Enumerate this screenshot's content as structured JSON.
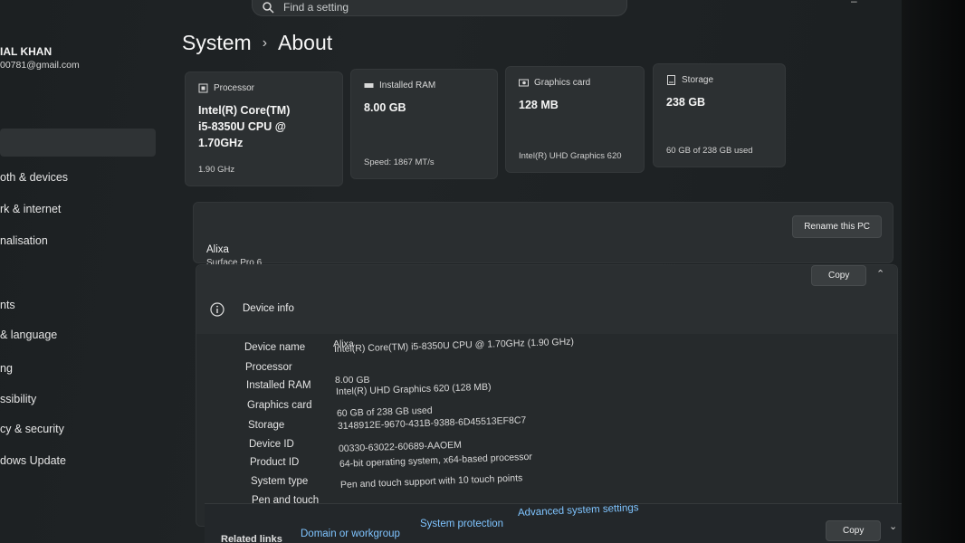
{
  "search": {
    "placeholder": "Find a setting"
  },
  "profile": {
    "name": "IAL KHAN",
    "email": "00781@gmail.com"
  },
  "nav": {
    "items": [
      {
        "label": "oth & devices"
      },
      {
        "label": "rk & internet"
      },
      {
        "label": "nalisation"
      },
      {
        "label": "nts"
      },
      {
        "label": "& language"
      },
      {
        "label": "ng"
      },
      {
        "label": "ssibility"
      },
      {
        "label": "cy & security"
      },
      {
        "label": "dows Update"
      }
    ]
  },
  "breadcrumb": {
    "parent": "System",
    "separator": "›",
    "current": "About"
  },
  "cards": [
    {
      "icon": "processor-icon",
      "title": "Processor",
      "value_lines": [
        "Intel(R) Core(TM)",
        "i5-8350U CPU @",
        "1.70GHz"
      ],
      "detail": "1.90 GHz"
    },
    {
      "icon": "ram-icon",
      "title": "Installed RAM",
      "value_lines": [
        "8.00 GB"
      ],
      "detail": "Speed: 1867 MT/s"
    },
    {
      "icon": "graphics-card-icon",
      "title": "Graphics card",
      "value_lines": [
        "128 MB"
      ],
      "detail": "Intel(R) UHD Graphics 620"
    },
    {
      "icon": "storage-icon",
      "title": "Storage",
      "value_lines": [
        "238 GB"
      ],
      "detail": "60 GB of 238 GB used"
    }
  ],
  "pc": {
    "name": "Alixa",
    "model": "Surface Pro 6",
    "rename_label": "Rename this PC"
  },
  "device_info": {
    "title": "Device info",
    "copy_label": "Copy",
    "specs": [
      {
        "label": "Device name",
        "value": "Alixa"
      },
      {
        "label": "Processor",
        "value": "Intel(R) Core(TM) i5-8350U CPU @ 1.70GHz (1.90 GHz)"
      },
      {
        "label": "Installed RAM",
        "value": "8.00 GB"
      },
      {
        "label": "Graphics card",
        "value": "Intel(R) UHD Graphics 620 (128 MB)"
      },
      {
        "label": "Storage",
        "value": "60 GB of 238 GB used"
      },
      {
        "label": "Device ID",
        "value": "3148912E-9670-431B-9388-6D45513EF8C7"
      },
      {
        "label": "Product ID",
        "value": "00330-63022-60689-AAOEM"
      },
      {
        "label": "System type",
        "value": "64-bit operating system, x64-based processor"
      },
      {
        "label": "Pen and touch",
        "value": "Pen and touch support with 10 touch points"
      }
    ]
  },
  "related": {
    "label": "Related links",
    "links": [
      "Domain or workgroup",
      "System protection",
      "Advanced system settings"
    ],
    "copy_label": "Copy"
  }
}
